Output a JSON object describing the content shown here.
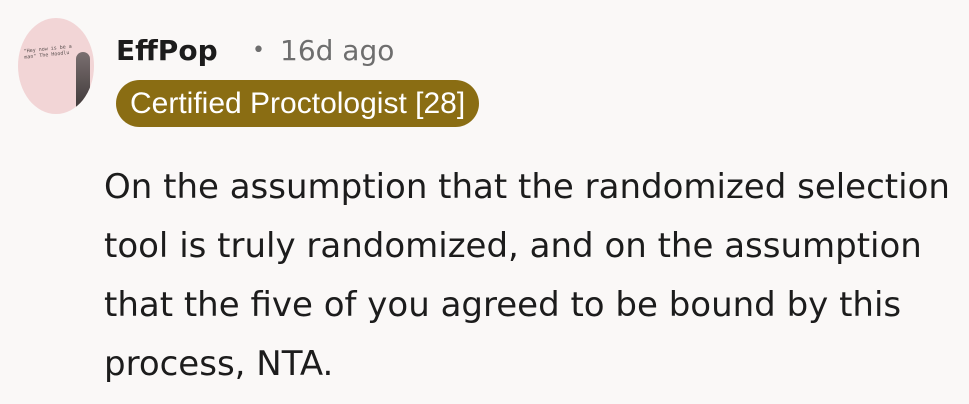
{
  "comment": {
    "author": "EffPop",
    "separator": "•",
    "timestamp": "16d ago",
    "flair": "Certified Proctologist [28]",
    "body": "On the assumption that the randomized selection tool is truly randomized, and on the assumption that the five of you agreed to be bound by this process, NTA.",
    "avatar_icon": "user-avatar-icon"
  },
  "colors": {
    "background": "#faf8f7",
    "flair_background": "#8a6d13",
    "flair_text": "#ffffff",
    "meta_text": "#6e6e6e",
    "body_text": "#1c1c1c"
  }
}
